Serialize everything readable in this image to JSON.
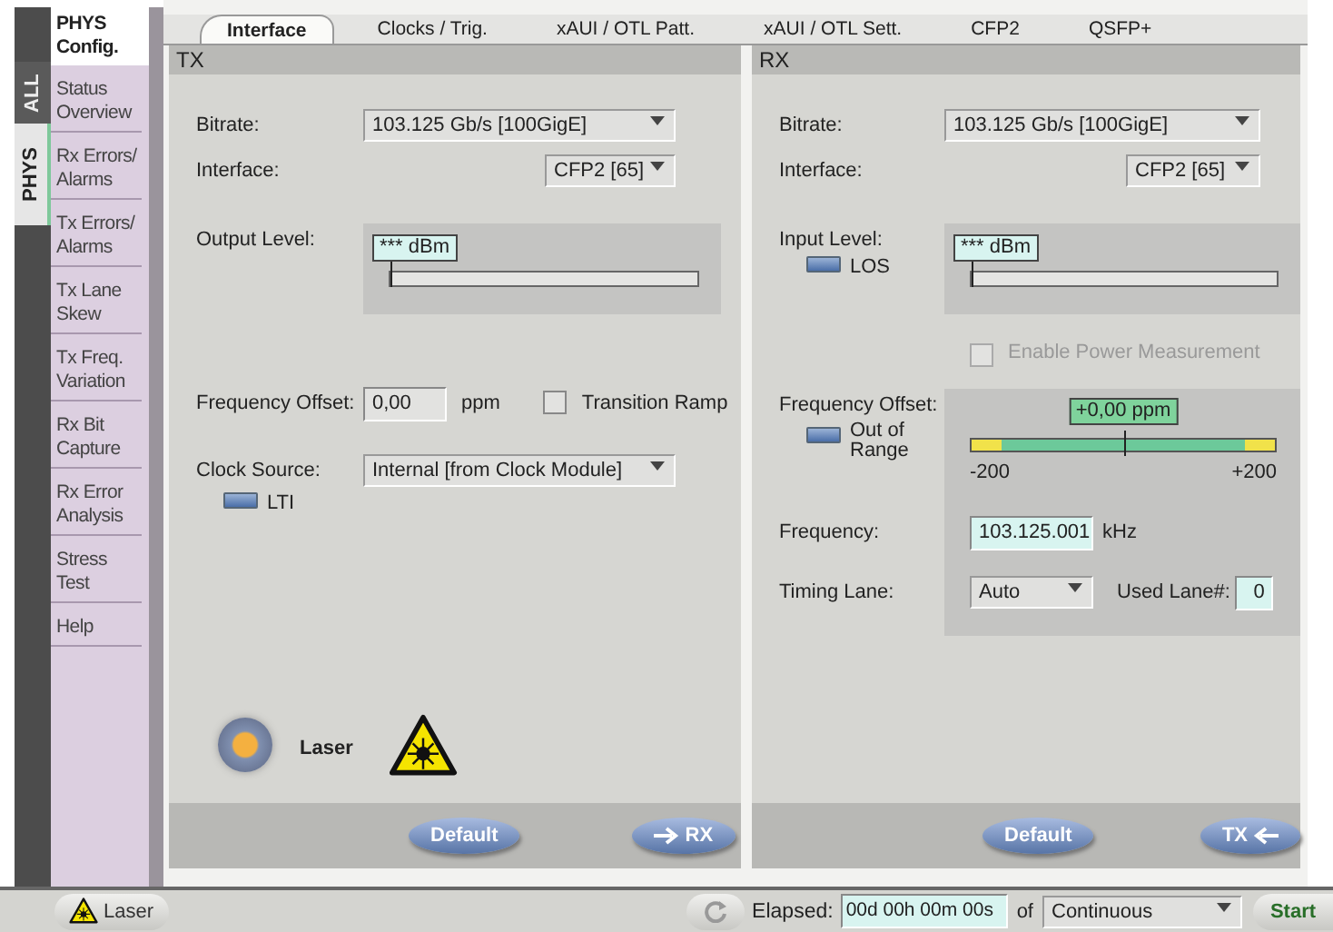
{
  "side_tabs": [
    {
      "label": "ALL",
      "selected": false
    },
    {
      "label": "PHYS",
      "selected": true
    }
  ],
  "sidebar": {
    "items": [
      {
        "label": "PHYS Config.",
        "selected": true
      },
      {
        "label": "Status Overview",
        "selected": false
      },
      {
        "label": "Rx Errors/ Alarms",
        "selected": false
      },
      {
        "label": "Tx Errors/ Alarms",
        "selected": false
      },
      {
        "label": "Tx Lane Skew",
        "selected": false
      },
      {
        "label": "Tx Freq. Variation",
        "selected": false
      },
      {
        "label": "Rx Bit Capture",
        "selected": false
      },
      {
        "label": "Rx Error Analysis",
        "selected": false
      },
      {
        "label": "Stress Test",
        "selected": false
      },
      {
        "label": "Help",
        "selected": false
      }
    ]
  },
  "tabs": [
    {
      "label": "Interface",
      "selected": true
    },
    {
      "label": "Clocks / Trig.",
      "selected": false
    },
    {
      "label": "xAUI / OTL Patt.",
      "selected": false
    },
    {
      "label": "xAUI / OTL Sett.",
      "selected": false
    },
    {
      "label": "CFP2",
      "selected": false
    },
    {
      "label": "QSFP+",
      "selected": false
    }
  ],
  "tx": {
    "title": "TX",
    "bitrate": {
      "label": "Bitrate:",
      "value": "103.125 Gb/s [100GigE]"
    },
    "interface": {
      "label": "Interface:",
      "value": "CFP2 [65]"
    },
    "output_level": {
      "label": "Output Level:",
      "reading": "*** dBm",
      "level": 0
    },
    "frequency_offset": {
      "label": "Frequency Offset:",
      "value": "0,00",
      "unit": "ppm"
    },
    "transition_ramp": {
      "label": "Transition Ramp",
      "checked": false
    },
    "clock_source": {
      "label": "Clock Source:",
      "value": "Internal [from Clock Module]"
    },
    "lti": {
      "label": "LTI",
      "on": false
    },
    "laser": {
      "label": "Laser",
      "on": true
    },
    "buttons": [
      {
        "label": "Default",
        "kind": "plain"
      },
      {
        "label": "RX",
        "kind": "arrow-right"
      }
    ]
  },
  "rx": {
    "title": "RX",
    "bitrate": {
      "label": "Bitrate:",
      "value": "103.125 Gb/s [100GigE]"
    },
    "interface": {
      "label": "Interface:",
      "value": "CFP2 [65]"
    },
    "input_level": {
      "label": "Input Level:",
      "reading": "*** dBm",
      "level": 0
    },
    "los": {
      "label": "LOS",
      "on": false
    },
    "power_measurement": {
      "label": "Enable Power Measurement",
      "checked": false,
      "disabled": true
    },
    "frequency_offset": {
      "label": "Frequency Offset:",
      "reading": "+0,00 ppm",
      "level": 0.5,
      "min_label": "-200",
      "max_label": "+200"
    },
    "out_of_range": {
      "label": "Out of Range",
      "on": false
    },
    "frequency": {
      "label": "Frequency:",
      "value": "103.125.001",
      "unit": "kHz"
    },
    "timing_lane": {
      "label": "Timing Lane:",
      "value": "Auto"
    },
    "used_lane": {
      "label": "Used Lane#:",
      "value": "0"
    },
    "buttons": [
      {
        "label": "Default",
        "kind": "plain"
      },
      {
        "label": "TX",
        "kind": "arrow-left"
      }
    ]
  },
  "status_bar": {
    "laser_button": "Laser",
    "elapsed_label": "Elapsed:",
    "elapsed": "00d 00h 00m 00s",
    "of_label": "of",
    "duration": "Continuous",
    "start": "Start"
  }
}
